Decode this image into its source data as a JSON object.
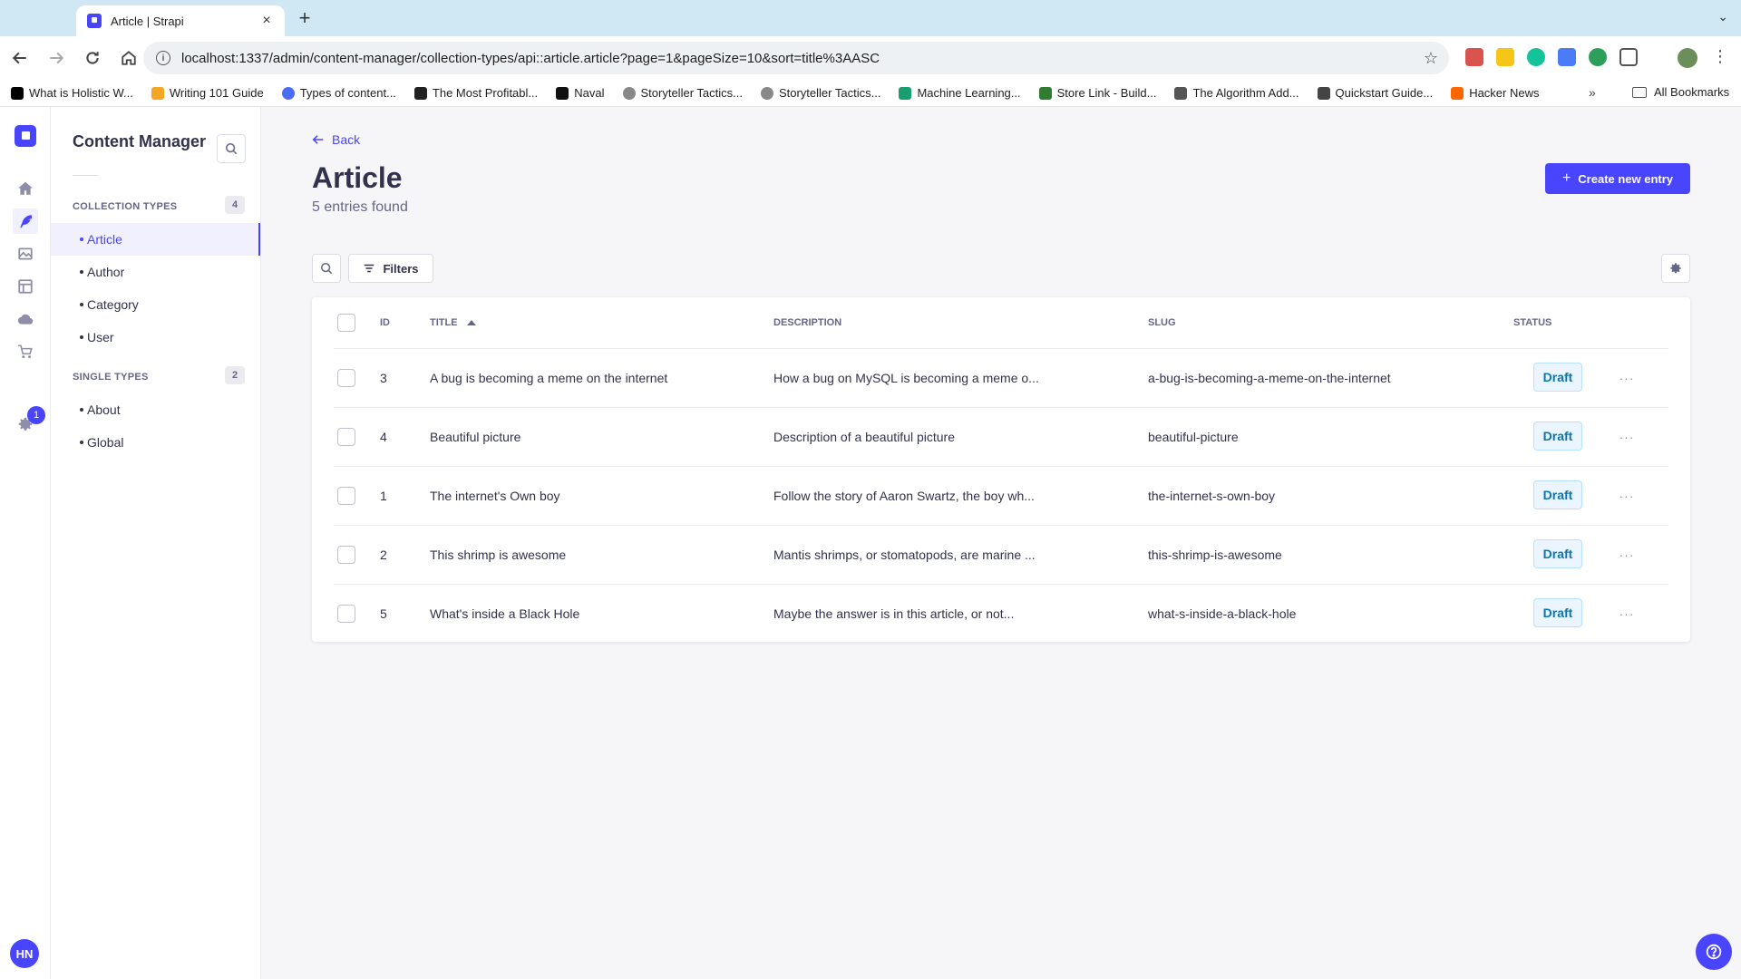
{
  "browser": {
    "tab_title": "Article | Strapi",
    "url": "localhost:1337/admin/content-manager/collection-types/api::article.article?page=1&pageSize=10&sort=title%3AASC",
    "bookmarks": [
      {
        "label": "What is Holistic W...",
        "color": "#000000"
      },
      {
        "label": "Writing 101 Guide",
        "color": "#f5a623"
      },
      {
        "label": "Types of content...",
        "color": "#4a6cf7"
      },
      {
        "label": "The Most Profitabl...",
        "color": "#222222"
      },
      {
        "label": "Naval",
        "color": "#111111"
      },
      {
        "label": "Storyteller Tactics...",
        "color": "#888888"
      },
      {
        "label": "Storyteller Tactics...",
        "color": "#888888"
      },
      {
        "label": "Machine Learning...",
        "color": "#1a9e6f"
      },
      {
        "label": "Store Link - Build...",
        "color": "#2e7d32"
      },
      {
        "label": "The Algorithm Add...",
        "color": "#555555"
      },
      {
        "label": "Quickstart Guide...",
        "color": "#444444"
      },
      {
        "label": "Hacker News",
        "color": "#ff6600"
      }
    ],
    "bookmarks_more": "»",
    "all_bookmarks": "All Bookmarks"
  },
  "mainnav": {
    "settings_badge": "1",
    "avatar_initials": "HN"
  },
  "subnav": {
    "title": "Content Manager",
    "collection_types_label": "COLLECTION TYPES",
    "collection_types_count": "4",
    "collection_types": [
      "Article",
      "Author",
      "Category",
      "User"
    ],
    "single_types_label": "SINGLE TYPES",
    "single_types_count": "2",
    "single_types": [
      "About",
      "Global"
    ]
  },
  "header": {
    "back_label": "Back",
    "title": "Article",
    "subtitle": "5 entries found",
    "create_label": "Create new entry"
  },
  "toolbar": {
    "filters_label": "Filters"
  },
  "table": {
    "columns": {
      "id": "ID",
      "title": "TITLE",
      "description": "DESCRIPTION",
      "slug": "SLUG",
      "status": "STATUS"
    },
    "rows": [
      {
        "id": "3",
        "title": "A bug is becoming a meme on the internet",
        "description": "How a bug on MySQL is becoming a meme o...",
        "slug": "a-bug-is-becoming-a-meme-on-the-internet",
        "status": "Draft"
      },
      {
        "id": "4",
        "title": "Beautiful picture",
        "description": "Description of a beautiful picture",
        "slug": "beautiful-picture",
        "status": "Draft"
      },
      {
        "id": "1",
        "title": "The internet's Own boy",
        "description": "Follow the story of Aaron Swartz, the boy wh...",
        "slug": "the-internet-s-own-boy",
        "status": "Draft"
      },
      {
        "id": "2",
        "title": "This shrimp is awesome",
        "description": "Mantis shrimps, or stomatopods, are marine ...",
        "slug": "this-shrimp-is-awesome",
        "status": "Draft"
      },
      {
        "id": "5",
        "title": "What's inside a Black Hole",
        "description": "Maybe the answer is in this article, or not...",
        "slug": "what-s-inside-a-black-hole",
        "status": "Draft"
      }
    ],
    "row_menu": "···"
  }
}
